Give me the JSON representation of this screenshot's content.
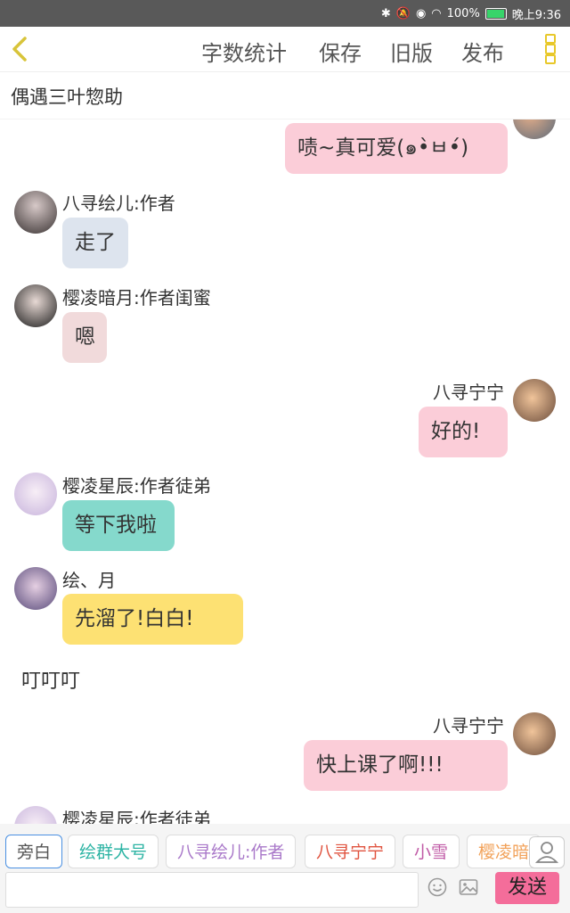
{
  "status": {
    "battery": "100%",
    "time": "晚上9:36"
  },
  "toolbar": {
    "word_count": "字数统计",
    "save": "保存",
    "old_version": "旧版",
    "publish": "发布"
  },
  "story_title": "偶遇三叶惣助",
  "messages": [
    {
      "side": "right",
      "text": "啧~真可爱(๑•̀ㅂ•́)",
      "name": ""
    },
    {
      "side": "left",
      "name": "八寻绘儿:作者",
      "text": "走了"
    },
    {
      "side": "left",
      "name": "樱凌暗月:作者闺蜜",
      "text": "嗯"
    },
    {
      "side": "right",
      "name": "八寻宁宁",
      "text": "好的!"
    },
    {
      "side": "left",
      "name": "樱凌星辰:作者徒弟",
      "text": "等下我啦"
    },
    {
      "side": "left",
      "name": "绘、月",
      "text": "先溜了!白白!"
    },
    {
      "side": "narration",
      "text": "叮叮叮"
    },
    {
      "side": "right",
      "name": "八寻宁宁",
      "text": "快上课了啊!!!"
    },
    {
      "side": "left",
      "name": "樱凌星辰:作者徒弟",
      "text": ""
    }
  ],
  "roles": [
    "旁白",
    "绘群大号",
    "八寻绘儿:作者",
    "八寻宁宁",
    "小雪",
    "樱凌暗"
  ],
  "input": {
    "value": "",
    "placeholder": ""
  },
  "send_label": "发送",
  "colors": {
    "pink_bubble": "#fbcdd8",
    "blue_bubble": "#dde4ee",
    "rose_bubble": "#f1dadb",
    "teal_bubble": "#85d9cc",
    "yellow_bubble": "#fde173",
    "send_button": "#f46d9a",
    "menu_accent": "#e8c82a"
  }
}
